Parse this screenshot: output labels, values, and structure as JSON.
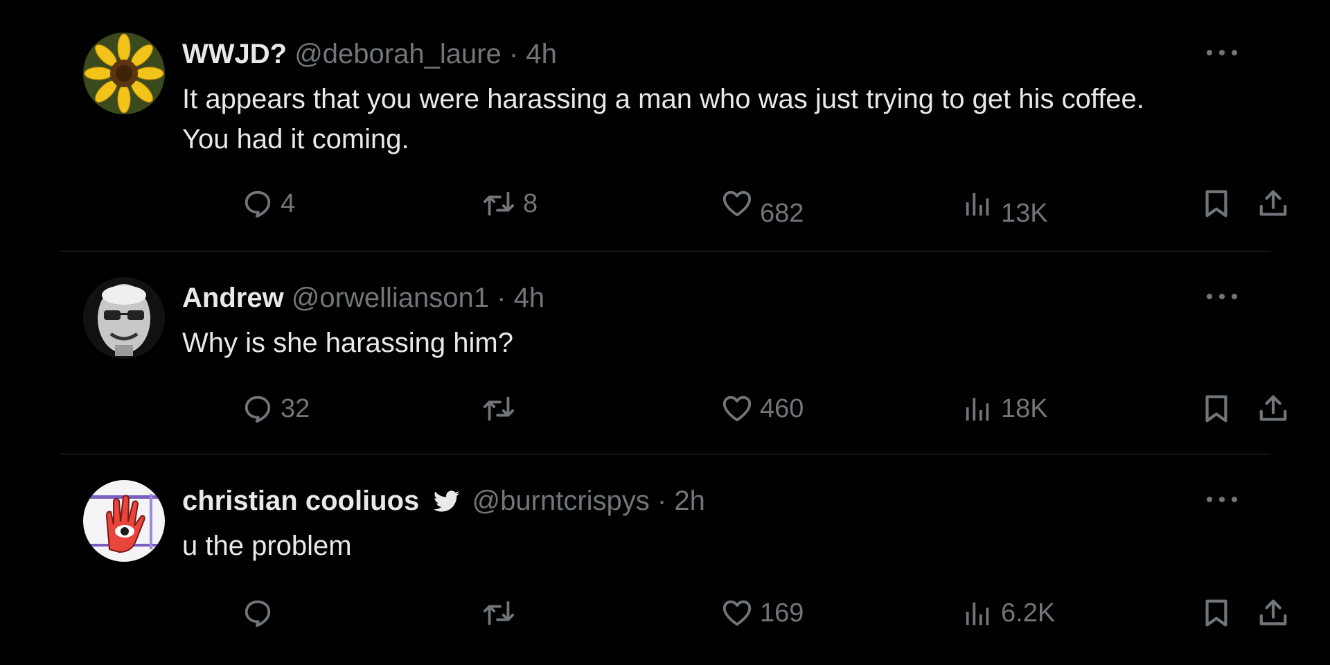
{
  "tweets": [
    {
      "name": "WWJD?",
      "handle": "@deborah_laure",
      "separator": "·",
      "time": "4h",
      "text": "It appears that you were harassing a man who was just trying to get his coffee. You had it coming.",
      "replies": "4",
      "reposts": "8",
      "likes": "682",
      "views": "13K",
      "avatar_icon": "sunflower-avatar"
    },
    {
      "name": "Andrew",
      "handle": "@orwellianson1",
      "separator": "·",
      "time": "4h",
      "text": "Why is she harassing him?",
      "replies": "32",
      "reposts": "",
      "likes": "460",
      "views": "18K",
      "avatar_icon": "face-avatar"
    },
    {
      "name": "christian cooliuos",
      "handle": "@burntcrispys",
      "separator": "·",
      "time": "2h",
      "text": "u the problem",
      "replies": "",
      "reposts": "",
      "likes": "169",
      "views": "6.2K",
      "avatar_icon": "hand-eye-avatar",
      "badge_icon": "bird-icon"
    }
  ],
  "colors": {
    "background": "#000000",
    "primary_text": "#e7e9ea",
    "secondary_text": "#71767b",
    "divider": "#2f3336"
  }
}
